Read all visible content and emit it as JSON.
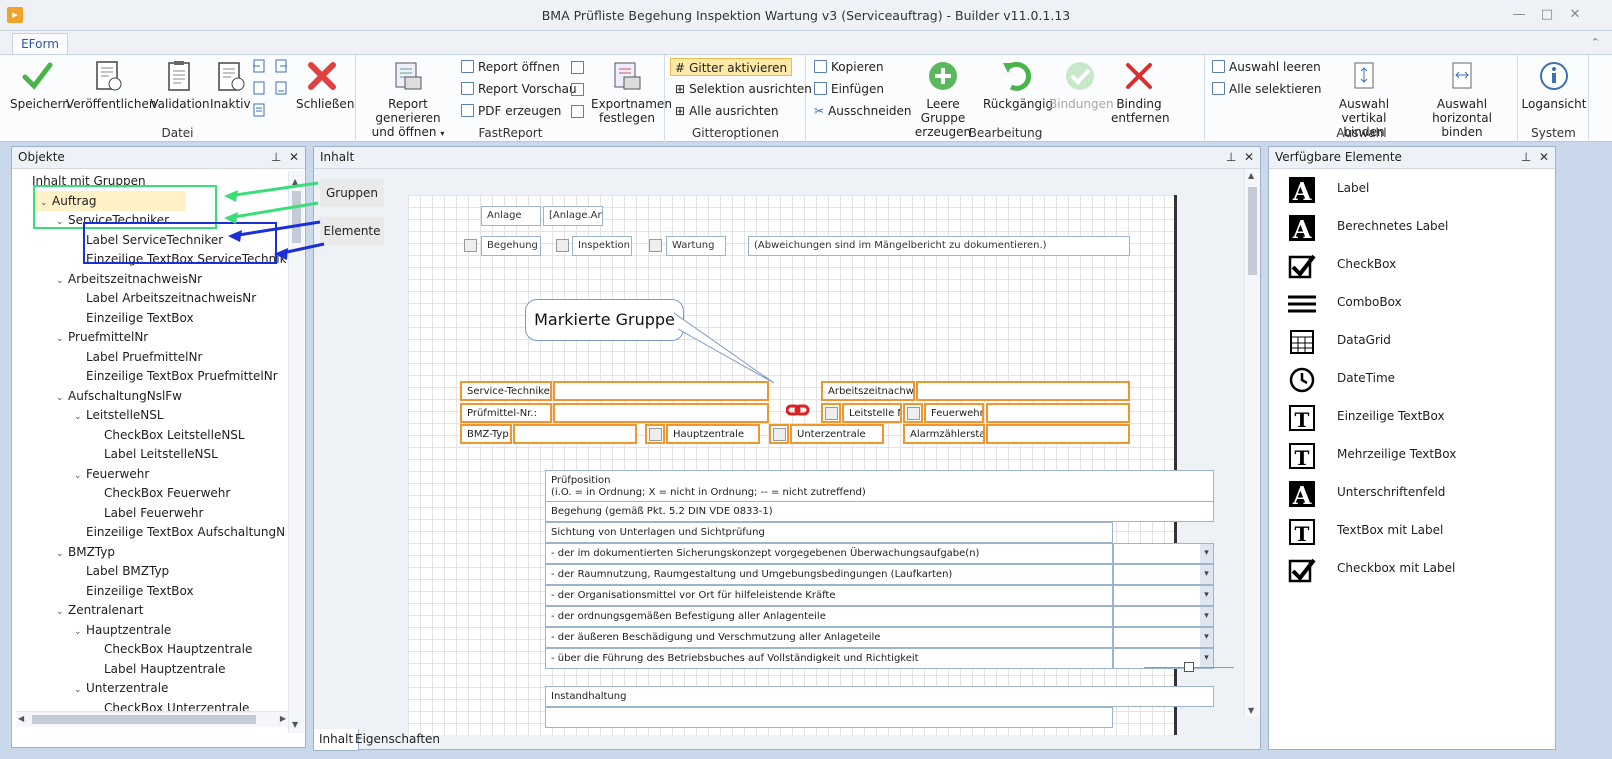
{
  "window": {
    "title": "BMA Prüfliste Begehung Inspektion Wartung v3 (Serviceauftrag) - Builder v11.0.1.13"
  },
  "tabs": {
    "active": "EForm"
  },
  "ribbon": {
    "datei": {
      "title": "Datei",
      "speichern": "Speichern",
      "veroeffentlichen": "Veröffentlichen",
      "validation": "Validation",
      "inaktiv": "Inaktiv",
      "schliessen": "Schließen"
    },
    "fastreport": {
      "title": "FastReport",
      "report_gen_1": "Report generieren",
      "report_gen_2": "und öffnen",
      "report_oeffnen": "Report öffnen",
      "report_vorschau": "Report Vorschau",
      "pdf_erzeugen": "PDF erzeugen",
      "exportnamen_1": "Exportnamen",
      "exportnamen_2": "festlegen"
    },
    "gitter": {
      "title": "Gitteroptionen",
      "gitter_aktivieren": "Gitter aktivieren",
      "selektion_ausrichten": "Selektion ausrichten",
      "alle_ausrichten": "Alle ausrichten"
    },
    "bearbeitung": {
      "title": "Bearbeitung",
      "kopieren": "Kopieren",
      "einfuegen": "Einfügen",
      "ausschneiden": "Ausschneiden",
      "leere_gruppe_1": "Leere Gruppe",
      "leere_gruppe_2": "erzeugen",
      "rueckgaengig": "Rückgängig",
      "bindungen": "Bindungen",
      "binding_entfernen_1": "Binding",
      "binding_entfernen_2": "entfernen"
    },
    "auswahl": {
      "title": "Auswahl",
      "auswahl_leeren": "Auswahl leeren",
      "alle_selektieren": "Alle selektieren",
      "vertikal_1": "Auswahl vertikal",
      "vertikal_2": "binden",
      "horizontal_1": "Auswahl horizontal",
      "horizontal_2": "binden"
    },
    "system": {
      "title": "System",
      "logansicht": "Logansicht"
    }
  },
  "objekte": {
    "title": "Objekte",
    "items": [
      {
        "label": "Inhalt mit Gruppen",
        "level": 0,
        "exp": "none"
      },
      {
        "label": "Auftrag",
        "level": 1,
        "exp": "open"
      },
      {
        "label": "ServiceTechniker",
        "level": 2,
        "exp": "open"
      },
      {
        "label": "Label ServiceTechniker",
        "level": 3,
        "exp": "none"
      },
      {
        "label": "Einzeilige TextBox ServiceTechniker",
        "level": 3,
        "exp": "none"
      },
      {
        "label": "ArbeitszeitnachweisNr",
        "level": 2,
        "exp": "open"
      },
      {
        "label": "Label ArbeitszeitnachweisNr",
        "level": 3,
        "exp": "none"
      },
      {
        "label": "Einzeilige TextBox",
        "level": 3,
        "exp": "none"
      },
      {
        "label": "PruefmittelNr",
        "level": 2,
        "exp": "open"
      },
      {
        "label": "Label PruefmittelNr",
        "level": 3,
        "exp": "none"
      },
      {
        "label": "Einzeilige TextBox PruefmittelNr",
        "level": 3,
        "exp": "none"
      },
      {
        "label": "AufschaltungNslFw",
        "level": 2,
        "exp": "open"
      },
      {
        "label": "LeitstelleNSL",
        "level": 3,
        "exp": "open"
      },
      {
        "label": "CheckBox LeitstelleNSL",
        "level": 4,
        "exp": "none"
      },
      {
        "label": "Label LeitstelleNSL",
        "level": 4,
        "exp": "none"
      },
      {
        "label": "Feuerwehr",
        "level": 3,
        "exp": "open"
      },
      {
        "label": "CheckBox Feuerwehr",
        "level": 4,
        "exp": "none"
      },
      {
        "label": "Label Feuerwehr",
        "level": 4,
        "exp": "none"
      },
      {
        "label": "Einzeilige TextBox AufschaltungNslFw",
        "level": 3,
        "exp": "none"
      },
      {
        "label": "BMZTyp",
        "level": 2,
        "exp": "open"
      },
      {
        "label": "Label BMZTyp",
        "level": 3,
        "exp": "none"
      },
      {
        "label": "Einzeilige TextBox",
        "level": 3,
        "exp": "none"
      },
      {
        "label": "Zentralenart",
        "level": 2,
        "exp": "open"
      },
      {
        "label": "Hauptzentrale",
        "level": 3,
        "exp": "open"
      },
      {
        "label": "CheckBox Hauptzentrale",
        "level": 4,
        "exp": "none"
      },
      {
        "label": "Label Hauptzentrale",
        "level": 4,
        "exp": "none"
      },
      {
        "label": "Unterzentrale",
        "level": 3,
        "exp": "open"
      },
      {
        "label": "CheckBox Unterzentrale",
        "level": 4,
        "exp": "none"
      }
    ]
  },
  "annotations": {
    "gruppen": "Gruppen",
    "elemente": "Elemente",
    "markierte_gruppe": "Markierte Gruppe"
  },
  "inhalt": {
    "title": "Inhalt",
    "anlage": "Anlage",
    "anlage_value": "[Anlage.Anla",
    "begehung": "Begehung",
    "inspektion": "Inspektion",
    "wartung": "Wartung",
    "abweichungen": "(Abweichungen sind im Mängelbericht zu dokumentieren.)",
    "service_techniker": "Service-Techniker:",
    "arbeitszeitnachweis": "Arbeitszeitnachwei",
    "pruefmittel": "Prüfmittel-Nr.:",
    "leitstelle": "Leitstelle N",
    "feuerwehr": "Feuerwehr",
    "bmz_typ": "BMZ-Typ",
    "hauptzentrale": "Hauptzentrale",
    "unterzentrale": "Unterzentrale",
    "alarmzaehler": "Alarmzählerstan",
    "pruefposition_1": "Prüfposition",
    "pruefposition_2": "(i.O. = in Ordnung; X = nicht in Ordnung; -- = nicht zutreffend)",
    "begehung_row": "Begehung (gemäß Pkt. 5.2 DIN VDE 0833-1)",
    "sichtung": "Sichtung von Unterlagen und Sichtprüfung",
    "rows": [
      "- der im dokumentierten Sicherungskonzept vorgegebenen Überwachungsaufgabe(n)",
      "- der Raumnutzung, Raumgestaltung und Umgebungsbedingungen (Laufkarten)",
      "- der Organisationsmittel vor Ort für hilfeleistende Kräfte",
      "- der ordnungsgemäßen Befestigung aller Anlagenteile",
      "- der äußeren Beschädigung und Verschmutzung aller Anlageteile",
      "- über die Führung des Betriebsbuches auf Vollständigkeit und Richtigkeit"
    ],
    "instandhaltung": "Instandhaltung"
  },
  "bottom_tabs": {
    "inhalt": "Inhalt",
    "eigenschaften": "Eigenschaften"
  },
  "verfuegbar": {
    "title": "Verfügbare Elemente",
    "items": [
      {
        "label": "Label",
        "icon": "label-icon"
      },
      {
        "label": "Berechnetes Label",
        "icon": "calculated-label-icon"
      },
      {
        "label": "CheckBox",
        "icon": "checkbox-icon"
      },
      {
        "label": "ComboBox",
        "icon": "combobox-icon"
      },
      {
        "label": "DataGrid",
        "icon": "datagrid-icon"
      },
      {
        "label": "DateTime",
        "icon": "datetime-icon"
      },
      {
        "label": "Einzeilige TextBox",
        "icon": "textbox-icon"
      },
      {
        "label": "Mehrzeilige TextBox",
        "icon": "multiline-textbox-icon"
      },
      {
        "label": "Unterschriftenfeld",
        "icon": "signature-icon"
      },
      {
        "label": "TextBox mit Label",
        "icon": "textbox-label-icon"
      },
      {
        "label": "Checkbox mit Label",
        "icon": "checkbox-label-icon"
      }
    ]
  },
  "colors": {
    "accent": "#2b5797",
    "orange_group": "#f0962e",
    "green_group": "#3cdc78",
    "blue_elements": "#1a2fd6"
  }
}
